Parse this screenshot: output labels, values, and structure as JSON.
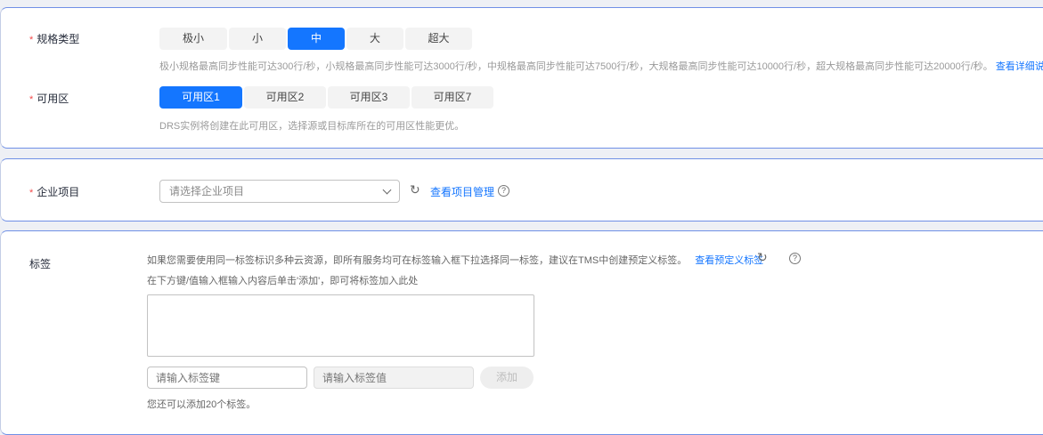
{
  "spec": {
    "label": "规格类型",
    "options": [
      "极小",
      "小",
      "中",
      "大",
      "超大"
    ],
    "selected": "中",
    "hint": "极小规格最高同步性能可达300行/秒，小规格最高同步性能可达3000行/秒，中规格最高同步性能可达7500行/秒，大规格最高同步性能可达10000行/秒，超大规格最高同步性能可达20000行/秒。",
    "link": "查看详细说明"
  },
  "az": {
    "label": "可用区",
    "options": [
      "可用区1",
      "可用区2",
      "可用区3",
      "可用区7"
    ],
    "selected": "可用区1",
    "hint": "DRS实例将创建在此可用区，选择源或目标库所在的可用区性能更优。"
  },
  "project": {
    "label": "企业项目",
    "placeholder": "请选择企业项目",
    "link": "查看项目管理"
  },
  "tags": {
    "label": "标签",
    "hint1": "如果您需要使用同一标签标识多种云资源，即所有服务均可在标签输入框下拉选择同一标签，建议在TMS中创建预定义标签。",
    "link": "查看预定义标签",
    "hint2": "在下方键/值输入框输入内容后单击'添加'，即可将标签加入此处",
    "key_placeholder": "请输入标签键",
    "value_placeholder": "请输入标签值",
    "add_label": "添加",
    "remaining": "您还可以添加20个标签。"
  }
}
